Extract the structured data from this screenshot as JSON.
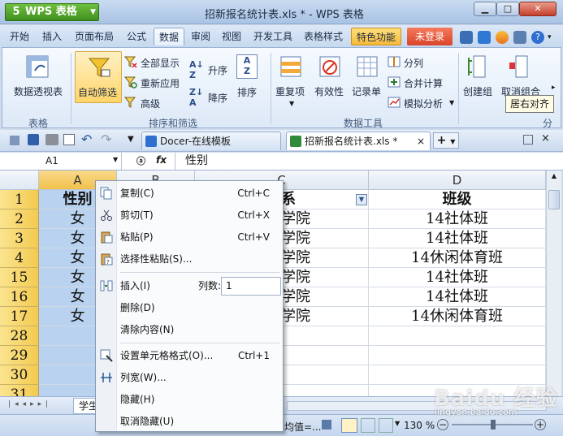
{
  "app": {
    "logo_label": "WPS 表格",
    "window_title": "招新报名统计表.xls * - WPS 表格"
  },
  "menu": {
    "tabs": [
      "开始",
      "插入",
      "页面布局",
      "公式",
      "数据",
      "审阅",
      "视图",
      "开发工具",
      "表格样式"
    ],
    "special": "特色功能",
    "login": "未登录",
    "active_tab": "数据"
  },
  "ribbon": {
    "pivot": "数据透视表",
    "table_group": "表格",
    "autofilter": "自动筛选",
    "show_all": "全部显示",
    "reapply": "重新应用",
    "advanced": "高级",
    "sort_filter_group": "排序和筛选",
    "asc": "升序",
    "desc": "降序",
    "sort": "排序",
    "dup": "重复项",
    "validity": "有效性",
    "record": "记录单",
    "split": "分列",
    "merge_calc": "合并计算",
    "sim": "模拟分析",
    "data_tools_group": "数据工具",
    "create_group": "创建组",
    "ungroup": "取消组合",
    "group_label": "分",
    "tooltip": "居右对齐"
  },
  "doctabs": {
    "docer": "Docer-在线模板",
    "file": "招新报名统计表.xls *"
  },
  "formula": {
    "namebox": "A1",
    "fx": "fx",
    "content": "性别"
  },
  "grid": {
    "columns": [
      "A",
      "B",
      "C",
      "D"
    ],
    "rows": [
      {
        "num": "1",
        "a": "性别",
        "c": "系",
        "d": "班级",
        "header": true
      },
      {
        "num": "2",
        "a": "女",
        "c": "学院",
        "d": "14社体班"
      },
      {
        "num": "3",
        "a": "女",
        "c": "学院",
        "d": "14社体班"
      },
      {
        "num": "4",
        "a": "女",
        "c": "学院",
        "d": "14休闲体育班"
      },
      {
        "num": "15",
        "a": "女",
        "c": "学院",
        "d": "14社体班"
      },
      {
        "num": "16",
        "a": "女",
        "c": "学院",
        "d": "14社体班"
      },
      {
        "num": "17",
        "a": "女",
        "c": "学院",
        "d": "14休闲体育班"
      },
      {
        "num": "28",
        "a": "",
        "c": "",
        "d": ""
      },
      {
        "num": "29",
        "a": "",
        "c": "",
        "d": ""
      },
      {
        "num": "30",
        "a": "",
        "c": "",
        "d": ""
      },
      {
        "num": "31",
        "a": "",
        "c": "",
        "d": ""
      }
    ]
  },
  "sheetbar": {
    "sheet_tab": "学生"
  },
  "status": {
    "sum_text": "均值=...",
    "zoom": "130 %"
  },
  "context_menu": {
    "copy": "复制(C)",
    "copy_sc": "Ctrl+C",
    "cut": "剪切(T)",
    "cut_sc": "Ctrl+X",
    "paste": "粘贴(P)",
    "paste_sc": "Ctrl+V",
    "paste_special": "选择性粘贴(S)...",
    "insert": "插入(I)",
    "cols_label": "列数:",
    "cols_value": "1",
    "delete": "删除(D)",
    "clear": "清除内容(N)",
    "format": "设置单元格格式(O)...",
    "format_sc": "Ctrl+1",
    "width": "列宽(W)...",
    "hide": "隐藏(H)",
    "unhide": "取消隐藏(U)"
  },
  "watermark": {
    "text": "Baidu 经验",
    "sub": "jingyan.baidu.com"
  }
}
